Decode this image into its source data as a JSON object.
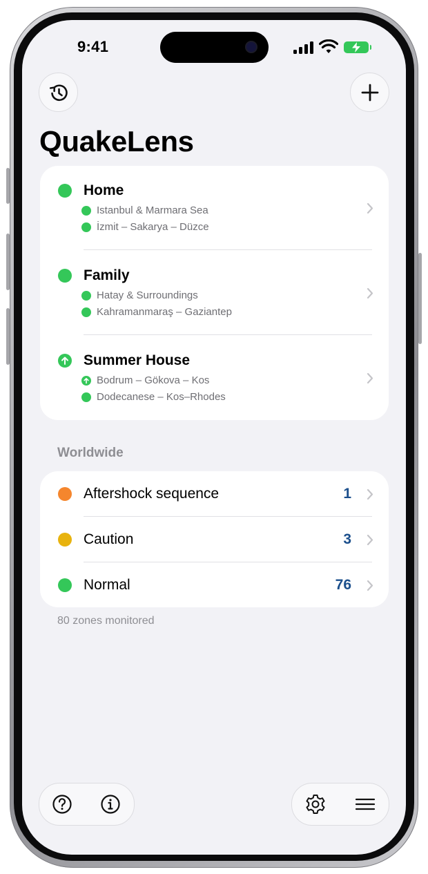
{
  "status_bar": {
    "time": "9:41"
  },
  "toolbar": {
    "history_icon": "history-icon",
    "add_icon": "plus-icon"
  },
  "app": {
    "title": "QuakeLens"
  },
  "my_zones": [
    {
      "name": "Home",
      "status": "normal",
      "color": "#34c759",
      "regions": [
        {
          "label": "Istanbul & Marmara Sea",
          "status": "normal"
        },
        {
          "label": "İzmit – Sakarya – Düzce",
          "status": "normal"
        }
      ]
    },
    {
      "name": "Family",
      "status": "normal",
      "color": "#34c759",
      "regions": [
        {
          "label": "Hatay & Surroundings",
          "status": "normal"
        },
        {
          "label": "Kahramanmaraş – Gaziantep",
          "status": "normal"
        }
      ]
    },
    {
      "name": "Summer House",
      "status": "rising",
      "color": "#34c759",
      "regions": [
        {
          "label": "Bodrum – Gökova – Kos",
          "status": "rising"
        },
        {
          "label": "Dodecanese – Kos–Rhodes",
          "status": "normal"
        }
      ]
    }
  ],
  "worldwide": {
    "title": "Worldwide",
    "rows": [
      {
        "label": "Aftershock sequence",
        "count": "1",
        "color": "#f5862d"
      },
      {
        "label": "Caution",
        "count": "3",
        "color": "#e8b30e"
      },
      {
        "label": "Normal",
        "count": "76",
        "color": "#34c759"
      }
    ],
    "footnote": "80 zones monitored"
  },
  "bottom_bar": {
    "left": [
      "help-icon",
      "info-icon"
    ],
    "right": [
      "settings-icon",
      "menu-icon"
    ]
  }
}
